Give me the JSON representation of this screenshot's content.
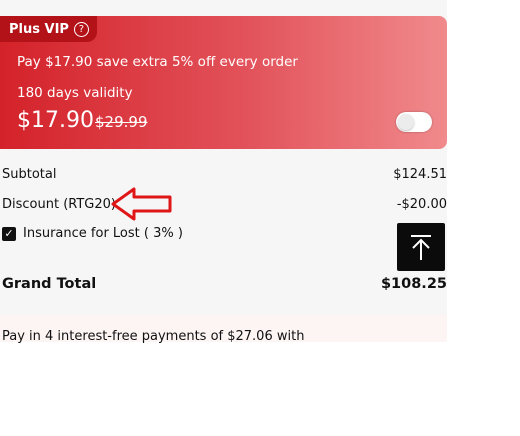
{
  "vip": {
    "tag_label": "Plus VIP",
    "help_glyph": "?",
    "offer_text": "Pay $17.90 save extra 5% off every order",
    "validity_text": "180 days validity",
    "price": "$17.90",
    "old_price": "$29.99",
    "toggle_on": false
  },
  "summary": {
    "subtotal_label": "Subtotal",
    "subtotal_value": "$124.51",
    "discount_label": "Discount (RTG20)",
    "discount_value": "-$20.00",
    "insurance_label": "Insurance for Lost ( 3% )",
    "insurance_checked": true,
    "grand_total_label": "Grand Total",
    "grand_total_value": "$108.25"
  },
  "payment_note": "Pay in 4 interest-free payments of $27.06 with",
  "colors": {
    "vip_gradient_start": "#d4222a",
    "vip_gradient_end": "#f08a8c",
    "annotation_arrow": "#e01515"
  }
}
